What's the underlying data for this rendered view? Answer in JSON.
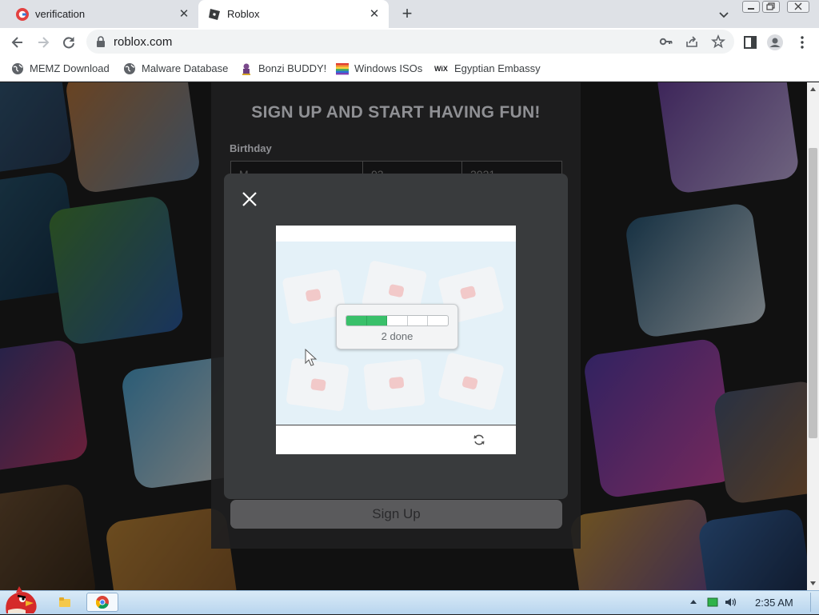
{
  "browser": {
    "tabs": [
      {
        "title": "verification",
        "active": false,
        "favicon": "red-g-logo-icon"
      },
      {
        "title": "Roblox",
        "active": true,
        "favicon": "roblox-logo-icon"
      }
    ],
    "url": "roblox.com",
    "bookmarks": [
      {
        "label": "MEMZ Download",
        "icon": "globe-icon"
      },
      {
        "label": "Malware Database",
        "icon": "globe-icon"
      },
      {
        "label": "Bonzi BUDDY!",
        "icon": "bonzi-icon"
      },
      {
        "label": "Windows ISOs",
        "icon": "windows-flag-icon"
      },
      {
        "label": "Egyptian Embassy",
        "icon": "wix-icon"
      }
    ],
    "wix_glyph": "WiX"
  },
  "page": {
    "heading": "SIGN UP AND START HAVING FUN!",
    "birthday_label": "Birthday",
    "birthday": {
      "month": "M",
      "day": "03",
      "year": "2021"
    },
    "signup_button": "Sign Up"
  },
  "captcha": {
    "progress_label": "2 done",
    "progress": {
      "done": 2,
      "total": 5
    },
    "accent_color": "#39c06a"
  },
  "taskbar": {
    "clock": "2:35 AM"
  }
}
